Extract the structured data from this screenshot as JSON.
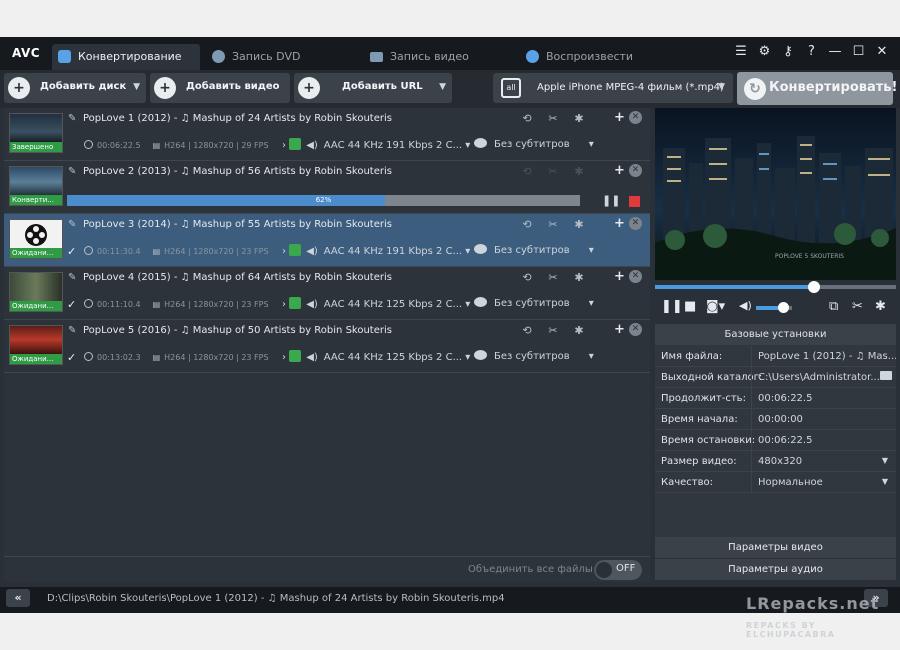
{
  "app": {
    "logo": "AVC"
  },
  "tabs": [
    {
      "label": "Конвертирование"
    },
    {
      "label": "Запись DVD"
    },
    {
      "label": "Запись видео"
    },
    {
      "label": "Воспроизвести"
    }
  ],
  "toolbar": {
    "add_disc": "Добавить диск",
    "add_video": "Добавить видео",
    "add_url": "Добавить URL",
    "profile": "Apple iPhone MPEG-4 фильм (*.mp4)",
    "convert": "Конвертировать!"
  },
  "files": [
    {
      "title": "PopLove 1 (2012) - ♫ Mashup of 24 Artists by Robin Skouteris",
      "status": "Завершено",
      "duration": "00:06:22.5",
      "video": "H264 | 1280x720 | 29 FPS",
      "audio": "AAC 44 KHz 191 Kbps 2 C...",
      "subtitles": "Без субтитров",
      "checked": false
    },
    {
      "title": "PopLove 2 (2013) - ♫ Mashup of 56 Artists by Robin Skouteris",
      "status": "Конверти...",
      "progress_text": "62%",
      "progress": 0.62
    },
    {
      "title": "PopLove 3 (2014) - ♫ Mashup of 55 Artists by Robin Skouteris",
      "status": "Ожидани...",
      "duration": "00:11:30.4",
      "video": "H264 | 1280x720 | 23 FPS",
      "audio": "AAC 44 KHz 191 Kbps 2 C...",
      "subtitles": "Без субтитров",
      "checked": true
    },
    {
      "title": "PopLove 4 (2015) - ♫ Mashup of 64 Artists by Robin Skouteris",
      "status": "Ожидани...",
      "duration": "00:11:10.4",
      "video": "H264 | 1280x720 | 23 FPS",
      "audio": "AAC 44 KHz 125 Kbps 2 C...",
      "subtitles": "Без субтитров",
      "checked": true
    },
    {
      "title": "PopLove 5 (2016) - ♫ Mashup of 50 Artists by Robin Skouteris",
      "status": "Ожидани...",
      "duration": "00:13:02.3",
      "video": "H264 | 1280x720 | 23 FPS",
      "audio": "AAC 44 KHz 125 Kbps 2 C...",
      "subtitles": "Без субтитров",
      "checked": true
    }
  ],
  "merge": {
    "label": "Объединить все файлы",
    "toggle": "OFF"
  },
  "player": {
    "position": 0.66,
    "volume": 0.75,
    "preview_text": "POPLOVE 5 SKOUTERIS"
  },
  "settings": {
    "title": "Базовые установки",
    "rows": [
      {
        "key": "Имя файла:",
        "value": "PopLove 1 (2012) - ♫ Mas..."
      },
      {
        "key": "Выходной каталог:",
        "value": "C:\\Users\\Administrator..."
      },
      {
        "key": "Продолжит-сть:",
        "value": "00:06:22.5"
      },
      {
        "key": "Время начала:",
        "value": "00:00:00"
      },
      {
        "key": "Время остановки:",
        "value": "00:06:22.5"
      },
      {
        "key": "Размер видео:",
        "value": "480x320"
      },
      {
        "key": "Качество:",
        "value": "Нормальное"
      }
    ],
    "video_params": "Параметры видео",
    "audio_params": "Параметры аудио"
  },
  "statusbar": {
    "path": "D:\\Clips\\Robin Skouteris\\PopLove 1 (2012) - ♫ Mashup of 24 Artists by Robin Skouteris.mp4",
    "prev": "«",
    "next": "»"
  },
  "watermark": {
    "line1": "LRepacks.net",
    "line2": "REPACKS BY ELCHUPACABRA"
  },
  "colors": {
    "accent": "#4a8ccc",
    "selected_row": "#3c5d7e",
    "done": "#2f9b45",
    "stop": "#e13a3a"
  }
}
